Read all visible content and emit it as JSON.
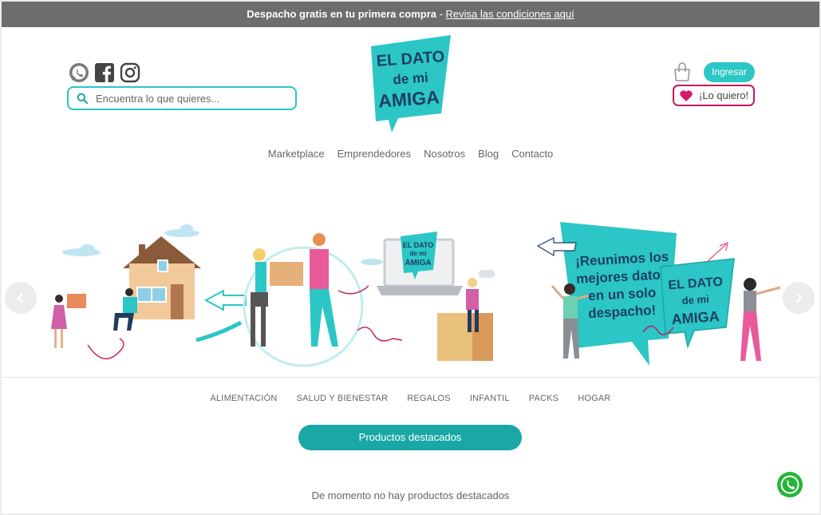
{
  "topbar": {
    "promo_bold": "Despacho gratis en tu primera compra",
    "separator": " - ",
    "promo_link": "Revisa las condiciones aquí"
  },
  "header": {
    "social_icons": [
      "whatsapp-icon",
      "facebook-icon",
      "instagram-icon"
    ],
    "search_placeholder": "Encuentra lo que quieres...",
    "logo_lines": [
      "EL DATO",
      "de mi",
      "AMIGA"
    ],
    "login_label": "Ingresar",
    "wishlist_label": "¡Lo quiero!"
  },
  "nav": {
    "items": [
      "Marketplace",
      "Emprendedores",
      "Nosotros",
      "Blog",
      "Contacto"
    ]
  },
  "banner": {
    "headline_lines": [
      "¡Reunimos los",
      "mejores datos",
      "en un solo",
      "despacho!"
    ],
    "sign_lines": [
      "EL DATO",
      "de mi",
      "AMIGA"
    ]
  },
  "categories": [
    "ALIMENTACIÓN",
    "SALUD Y BIENESTAR",
    "REGALOS",
    "INFANTIL",
    "PACKS",
    "HOGAR"
  ],
  "featured": {
    "button_label": "Productos destacados",
    "empty_message": "De momento no hay productos destacados"
  },
  "colors": {
    "accent": "#2bc6c5",
    "accent_dark": "#1aa8a7",
    "pink": "#c1195f",
    "topbar": "#6d6d6d"
  }
}
